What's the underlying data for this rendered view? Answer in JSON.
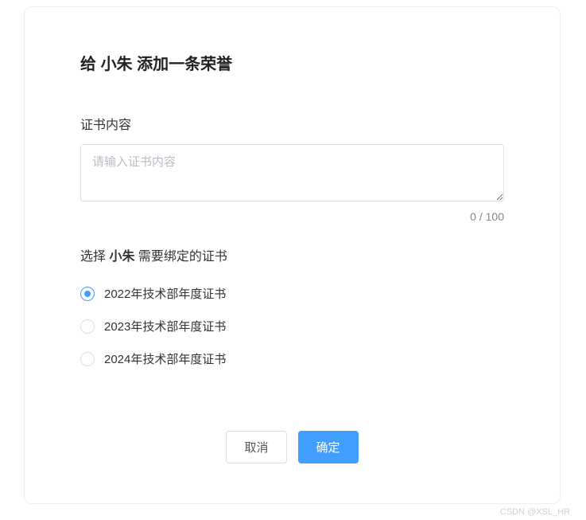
{
  "title": {
    "prefix": "给 ",
    "name": "小朱",
    "suffix": " 添加一条荣誉"
  },
  "content": {
    "label": "证书内容",
    "placeholder": "请输入证书内容",
    "value": "",
    "counter": "0 / 100"
  },
  "select": {
    "prefix": "选择 ",
    "name": "小朱",
    "suffix": " 需要绑定的证书"
  },
  "certificates": [
    {
      "label": "2022年技术部年度证书",
      "selected": true
    },
    {
      "label": "2023年技术部年度证书",
      "selected": false
    },
    {
      "label": "2024年技术部年度证书",
      "selected": false
    }
  ],
  "buttons": {
    "cancel": "取消",
    "confirm": "确定"
  },
  "watermark": "CSDN @XSL_HR"
}
